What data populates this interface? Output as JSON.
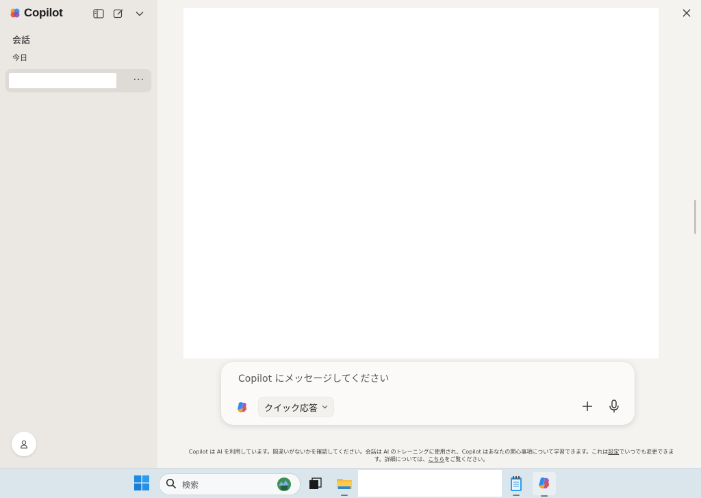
{
  "app": {
    "brand": "Copilot",
    "brand_colors": [
      "#e74c3c",
      "#f5a623",
      "#2d8cf0",
      "#8e44ad"
    ]
  },
  "sidebar": {
    "section_title": "会話",
    "group_label": "今日",
    "conversations": [
      {
        "title": "",
        "more_label": "···"
      }
    ],
    "icons": [
      "sidebar-toggle-icon",
      "new-chat-icon",
      "chevron-down-icon"
    ]
  },
  "composer": {
    "placeholder": "Copilot にメッセージしてください",
    "mode_label": "クイック応答",
    "mode_options_visible": [
      "クイック応答"
    ]
  },
  "disclaimer": {
    "part1": "Copilot は AI を利用しています。間違いがないかを確認してください。会話は AI のトレーニングに使用され、Copilot はあなたの関心事項について学習できます。これは",
    "settings_link": "設定",
    "part2": "でいつでも変更できます。詳細については、",
    "here_link": "こちら",
    "part3": "をご覧ください。"
  },
  "taskbar": {
    "search_label": "検索",
    "items": [
      "start-icon",
      "search",
      "task-view-icon",
      "file-explorer-icon",
      "notepad-icon",
      "copilot-taskbar-icon"
    ]
  }
}
